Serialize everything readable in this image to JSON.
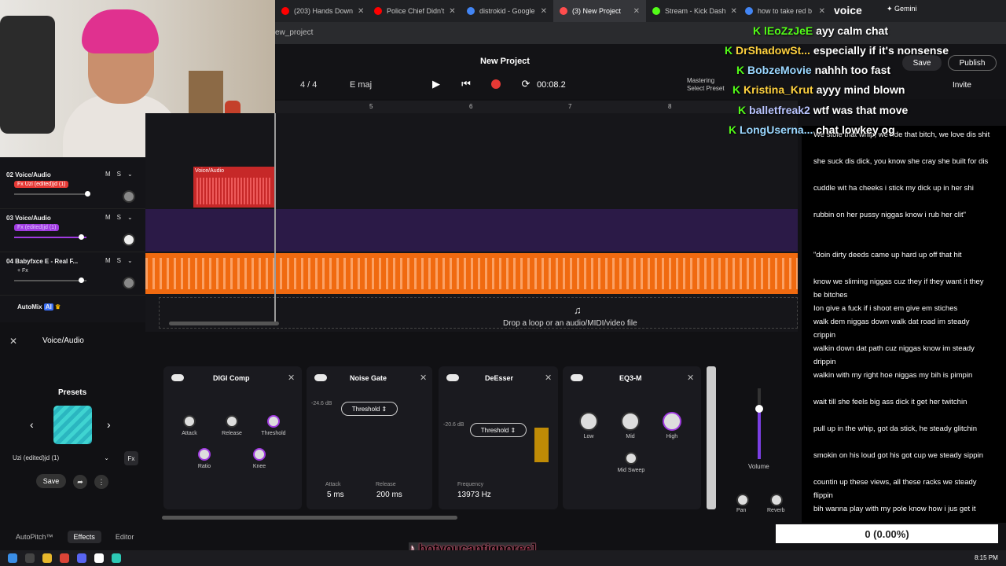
{
  "browser": {
    "tabs": [
      {
        "label": "(203) Hands Down",
        "color": "#ff0000"
      },
      {
        "label": "Police Chief Didn't",
        "color": "#ff0000"
      },
      {
        "label": "distrokid - Google",
        "color": "#4285f4"
      },
      {
        "label": "(3) New Project",
        "color": "#ff4d4d"
      },
      {
        "label": "Stream - Kick Dash",
        "color": "#53fc18"
      },
      {
        "label": "how to take red b",
        "color": "#4285f4"
      }
    ],
    "url": "ew_project",
    "gemini": "Gemini"
  },
  "overlay": {
    "voice_word": "voice",
    "chat": [
      {
        "user": "lEoZzJeE",
        "user_color": "#53fc18",
        "msg": "ayy calm chat"
      },
      {
        "user": "DrShadowSt...",
        "user_color": "#ffd23f",
        "msg": "especially if it's nonsense"
      },
      {
        "user": "BobzeMovie",
        "user_color": "#9ad7ff",
        "msg": "nahhh too fast"
      },
      {
        "user": "Kristina_Krut",
        "user_color": "#ffd23f",
        "msg": "ayyy mind blown"
      },
      {
        "user": "balletfreak2",
        "user_color": "#b9c4ff",
        "msg": "wtf was that move"
      },
      {
        "user": "LongUserna...",
        "user_color": "#9ad7ff",
        "msg": "chat lowkey og"
      }
    ],
    "counter": "0 (0.00%)",
    "tiktok_handle": "botyoucantignoree]"
  },
  "daw": {
    "project_title": "New Project",
    "bar": "4 / 4",
    "key": "E maj",
    "time": "00:08.2",
    "mastering_label": "Mastering",
    "mastering_sub": "Select Preset",
    "save": "Save",
    "publish": "Publish",
    "invite": "Invite",
    "ruler_marks": [
      "5",
      "6",
      "7",
      "8"
    ],
    "tracks": [
      {
        "name": "02 Voice/Audio",
        "tag": "Fx Uzi (edited)jd (1)",
        "tag_color": "#e53935",
        "fader": 0.95
      },
      {
        "name": "03 Voice/Audio",
        "tag": "Fx (edited)jd (1)",
        "tag_color": "#a03be0",
        "fader": 0.9
      },
      {
        "name": "04 Babyfxce E - Real F...",
        "tag": "+ Fx",
        "tag_color": "transparent",
        "fader": 0.9
      }
    ],
    "clip_label": "Voice/Audio",
    "automix": "AutoMix",
    "drop_text": "Drop a loop or an audio/MIDI/video file"
  },
  "fx": {
    "header": "Voice/Audio",
    "presets_label": "Presets",
    "preset_name": "Uzi (edited)jd (1)",
    "save": "Save",
    "cards": {
      "digicomp": {
        "title": "DIGI Comp",
        "knobs": [
          "Attack",
          "Release",
          "Threshold",
          "Ratio",
          "Knee"
        ]
      },
      "noisegate": {
        "title": "Noise Gate",
        "threshold_label": "Threshold",
        "db": "-24.6 dB",
        "attack_label": "Attack",
        "attack_val": "5 ms",
        "release_label": "Release",
        "release_val": "200 ms"
      },
      "deesser": {
        "title": "DeEsser",
        "threshold_label": "Threshold",
        "db": "-20.6 dB",
        "freq_label": "Frequency",
        "freq_val": "13973 Hz"
      },
      "eq": {
        "title": "EQ3-M",
        "knobs": [
          "Low",
          "Mid",
          "High",
          "Mid Sweep"
        ]
      }
    },
    "volume_label": "Volume",
    "volume_level": 0.73,
    "pan_label": "Pan",
    "reverb_label": "Reverb",
    "bottom_tabs": [
      "AutoPitch™",
      "Effects",
      "Editor"
    ]
  },
  "lyrics": [
    "We stole that whip, we ride that bitch, we love dis shit",
    "she suck dis dick, you know she cray she built for dis",
    "cuddle wit ha cheeks i stick my dick up in her shi",
    "rubbin on her pussy niggas know i rub her clit\"",
    "\"doin dirty deeds came up hard up off that hit",
    "know we sliming niggas cuz they if they want it they be bitches",
    "Ion give a fuck if i shoot em give em stiches",
    "walk dem niggas down walk dat road im steady crippin",
    "walkin down dat path cuz niggas know im steady drippin",
    "walkin with my right hoe niggas my bih is pimpin",
    "wait till she feels big ass dick it get her twitchin",
    "pull up in the whip, got da stick, he steady glitchin",
    "smokin on his loud got his got cup we steady sippin",
    "countin up these views, all these racks we steady flippin",
    "bih wanna play with my pole know how i jus get it"
  ],
  "taskbar": {
    "clock": "8:15 PM"
  }
}
